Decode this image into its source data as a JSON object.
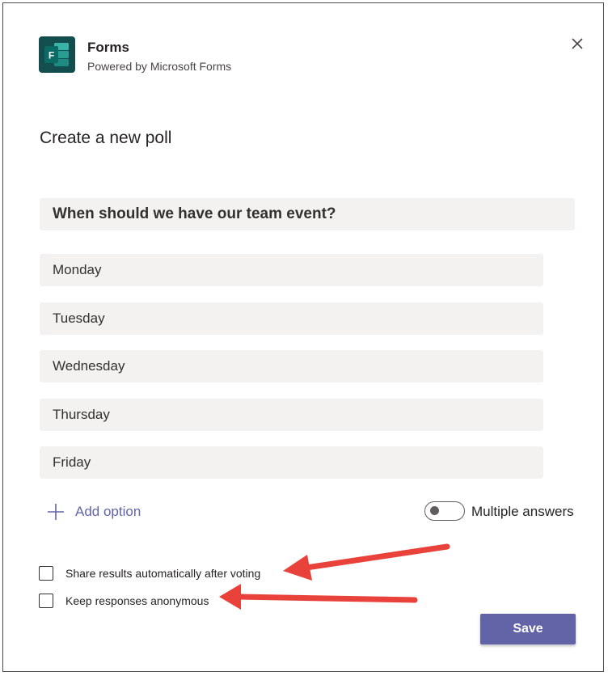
{
  "app": {
    "name": "Forms",
    "subtitle": "Powered by Microsoft Forms",
    "icon": "microsoft-forms-icon"
  },
  "dialog": {
    "title": "Create a new poll",
    "close_icon": "close-icon"
  },
  "poll": {
    "question": "When should we have our team event?",
    "options": [
      "Monday",
      "Tuesday",
      "Wednesday",
      "Thursday",
      "Friday"
    ],
    "add_option_label": "Add option",
    "multiple_answers_label": "Multiple answers",
    "multiple_answers_enabled": false
  },
  "settings": {
    "share_results_label": "Share results automatically after voting",
    "share_results_checked": false,
    "anonymous_label": "Keep responses anonymous",
    "anonymous_checked": false
  },
  "actions": {
    "save_label": "Save"
  },
  "colors": {
    "accent": "#6264a7",
    "annotation_arrow": "#e8423a",
    "field_background": "#f3f2f1",
    "forms_brand": "#0f5c5c"
  }
}
